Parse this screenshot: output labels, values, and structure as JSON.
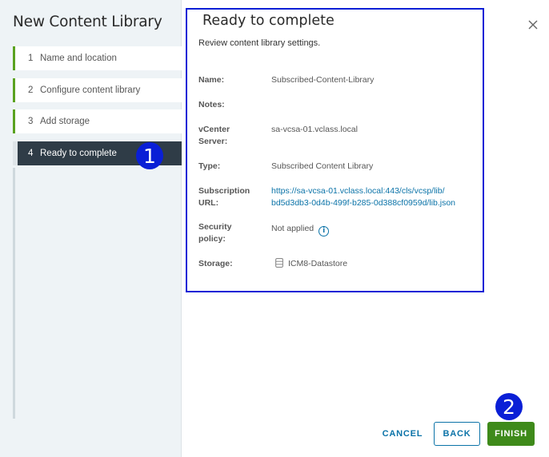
{
  "wizard": {
    "title": "New Content Library",
    "steps": [
      {
        "num": "1",
        "label": "Name and location"
      },
      {
        "num": "2",
        "label": "Configure content library"
      },
      {
        "num": "3",
        "label": "Add storage"
      },
      {
        "num": "4",
        "label": "Ready to complete"
      }
    ],
    "active_step": 4
  },
  "annotations": {
    "badge1": "1",
    "badge2": "2"
  },
  "page": {
    "title": "Ready to complete",
    "subtitle": "Review content library settings."
  },
  "summary": {
    "name_label": "Name:",
    "name_value": "Subscribed-Content-Library",
    "notes_label": "Notes:",
    "notes_value": "",
    "vcenter_label_1": "vCenter",
    "vcenter_label_2": "Server:",
    "vcenter_value": "sa-vcsa-01.vclass.local",
    "type_label": "Type:",
    "type_value": "Subscribed Content Library",
    "url_label_1": "Subscription",
    "url_label_2": "URL:",
    "url_value_1": "https://sa-vcsa-01.vclass.local:443/cls/vcsp/lib/",
    "url_value_2": "bd5d3db3-0d4b-499f-b285-0d388cf0959d/lib.json",
    "security_label_1": "Security",
    "security_label_2": "policy:",
    "security_value": "Not applied",
    "info_glyph": "i",
    "storage_label": "Storage:",
    "storage_value": "ICM8-Datastore"
  },
  "buttons": {
    "cancel": "CANCEL",
    "back": "BACK",
    "finish": "FINISH"
  },
  "colors": {
    "accent": "#0b73a8",
    "finish": "#3e8a1a",
    "step_complete": "#5aa220",
    "active_step_bg": "#2f3c47",
    "annotation": "#0a1fd6"
  },
  "icons": {
    "close": "close-icon",
    "info": "info-icon",
    "datastore": "datastore-icon"
  }
}
